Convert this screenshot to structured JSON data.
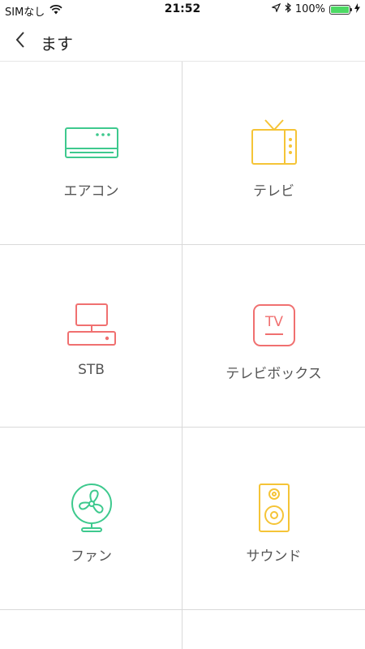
{
  "status_bar": {
    "carrier": "SIMなし",
    "time": "21:52",
    "battery_percent": "100%",
    "battery_level": 1.0,
    "icons": [
      "wifi-icon",
      "location-arrow-icon",
      "bluetooth-icon",
      "battery-icon",
      "charging-icon"
    ]
  },
  "nav": {
    "back_icon": "chevron-left-icon",
    "title": "ます"
  },
  "devices": [
    {
      "label": "エアコン",
      "icon": "air-conditioner-icon",
      "color": "#3ec98e"
    },
    {
      "label": "テレビ",
      "icon": "tv-icon",
      "color": "#f5c437"
    },
    {
      "label": "STB",
      "icon": "stb-icon",
      "color": "#f07070"
    },
    {
      "label": "テレビボックス",
      "icon": "tv-box-icon",
      "color": "#f07070",
      "icon_text": "TV"
    },
    {
      "label": "ファン",
      "icon": "fan-icon",
      "color": "#3ec98e"
    },
    {
      "label": "サウンド",
      "icon": "speaker-icon",
      "color": "#f5c437"
    }
  ]
}
